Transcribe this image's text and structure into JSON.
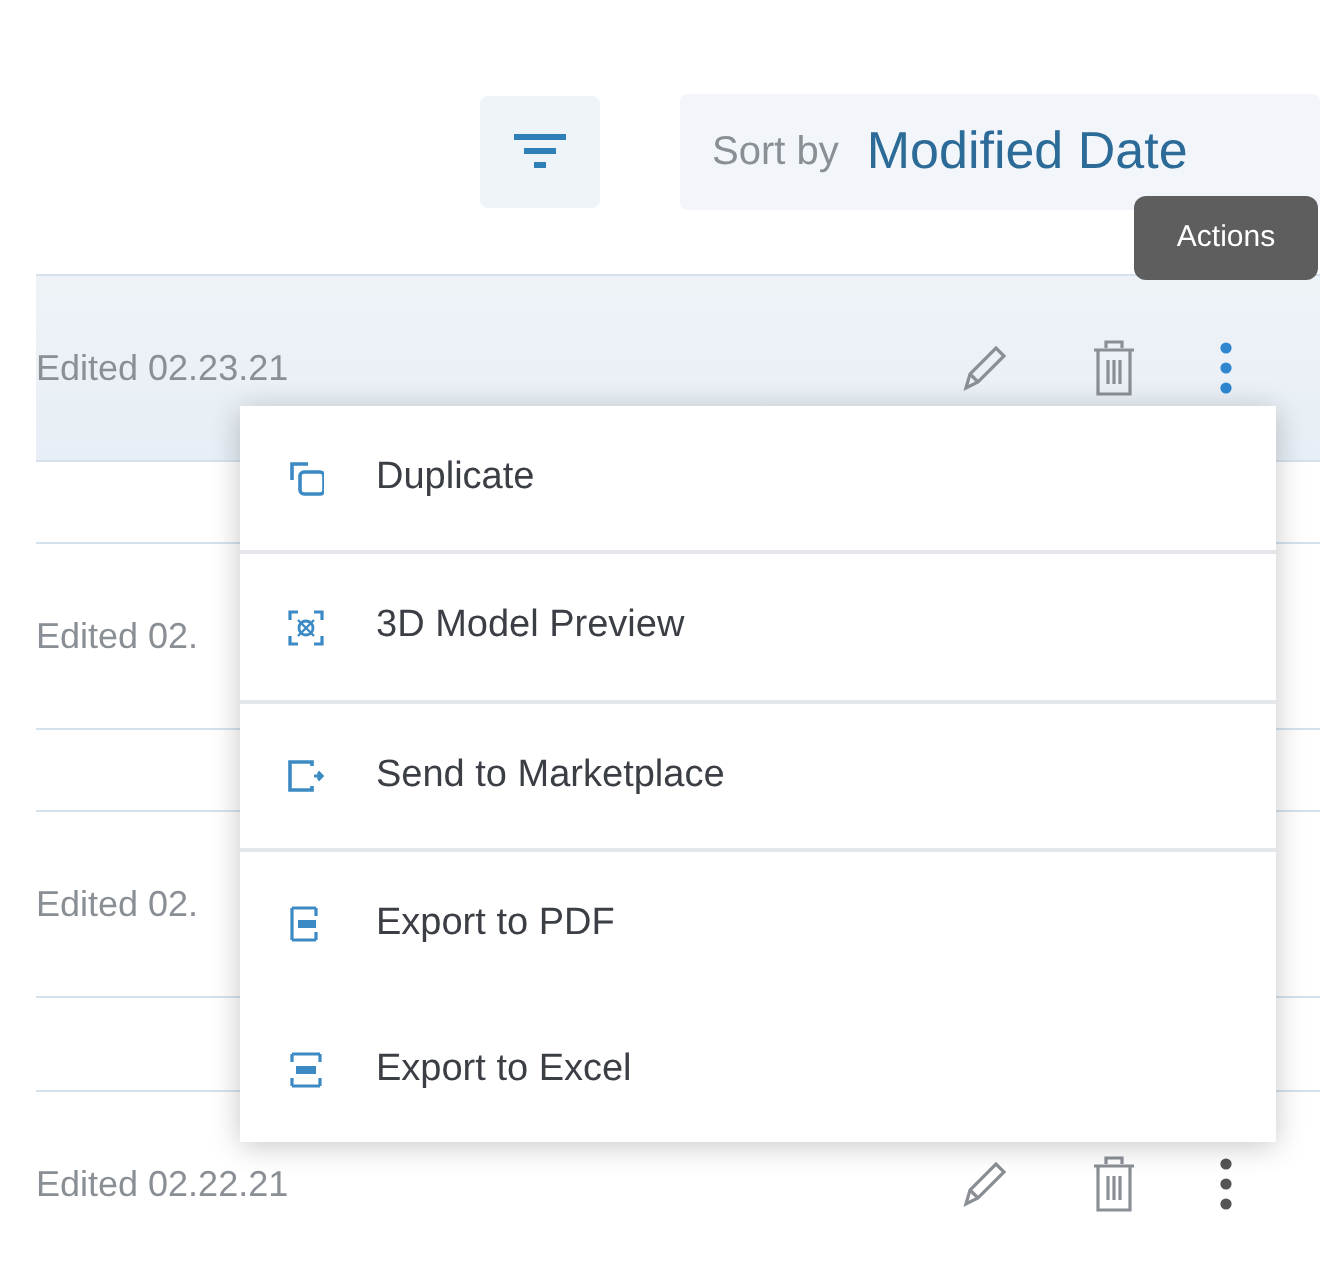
{
  "toolbar": {
    "sort": {
      "label": "Sort by",
      "value": "Modified Date"
    }
  },
  "tooltip": "Actions",
  "rows": [
    {
      "text": "Edited 02.23.21",
      "selected": true,
      "actions_shown": true
    },
    {
      "text": "Edited 02.",
      "selected": false
    },
    {
      "text": "Edited 02.",
      "selected": false
    },
    {
      "text": "Edited 02.22.21",
      "selected": false,
      "actions_shown": true
    }
  ],
  "menu": [
    {
      "kind": "duplicate",
      "label": "Duplicate",
      "separator_below": true
    },
    {
      "kind": "model",
      "label": "3D Model Preview",
      "separator_below": true
    },
    {
      "kind": "send",
      "label": "Send to Marketplace",
      "separator_below": true
    },
    {
      "kind": "pdf",
      "label": "Export to PDF",
      "separator_below": false
    },
    {
      "kind": "excel",
      "label": "Export to Excel",
      "separator_below": false
    }
  ]
}
